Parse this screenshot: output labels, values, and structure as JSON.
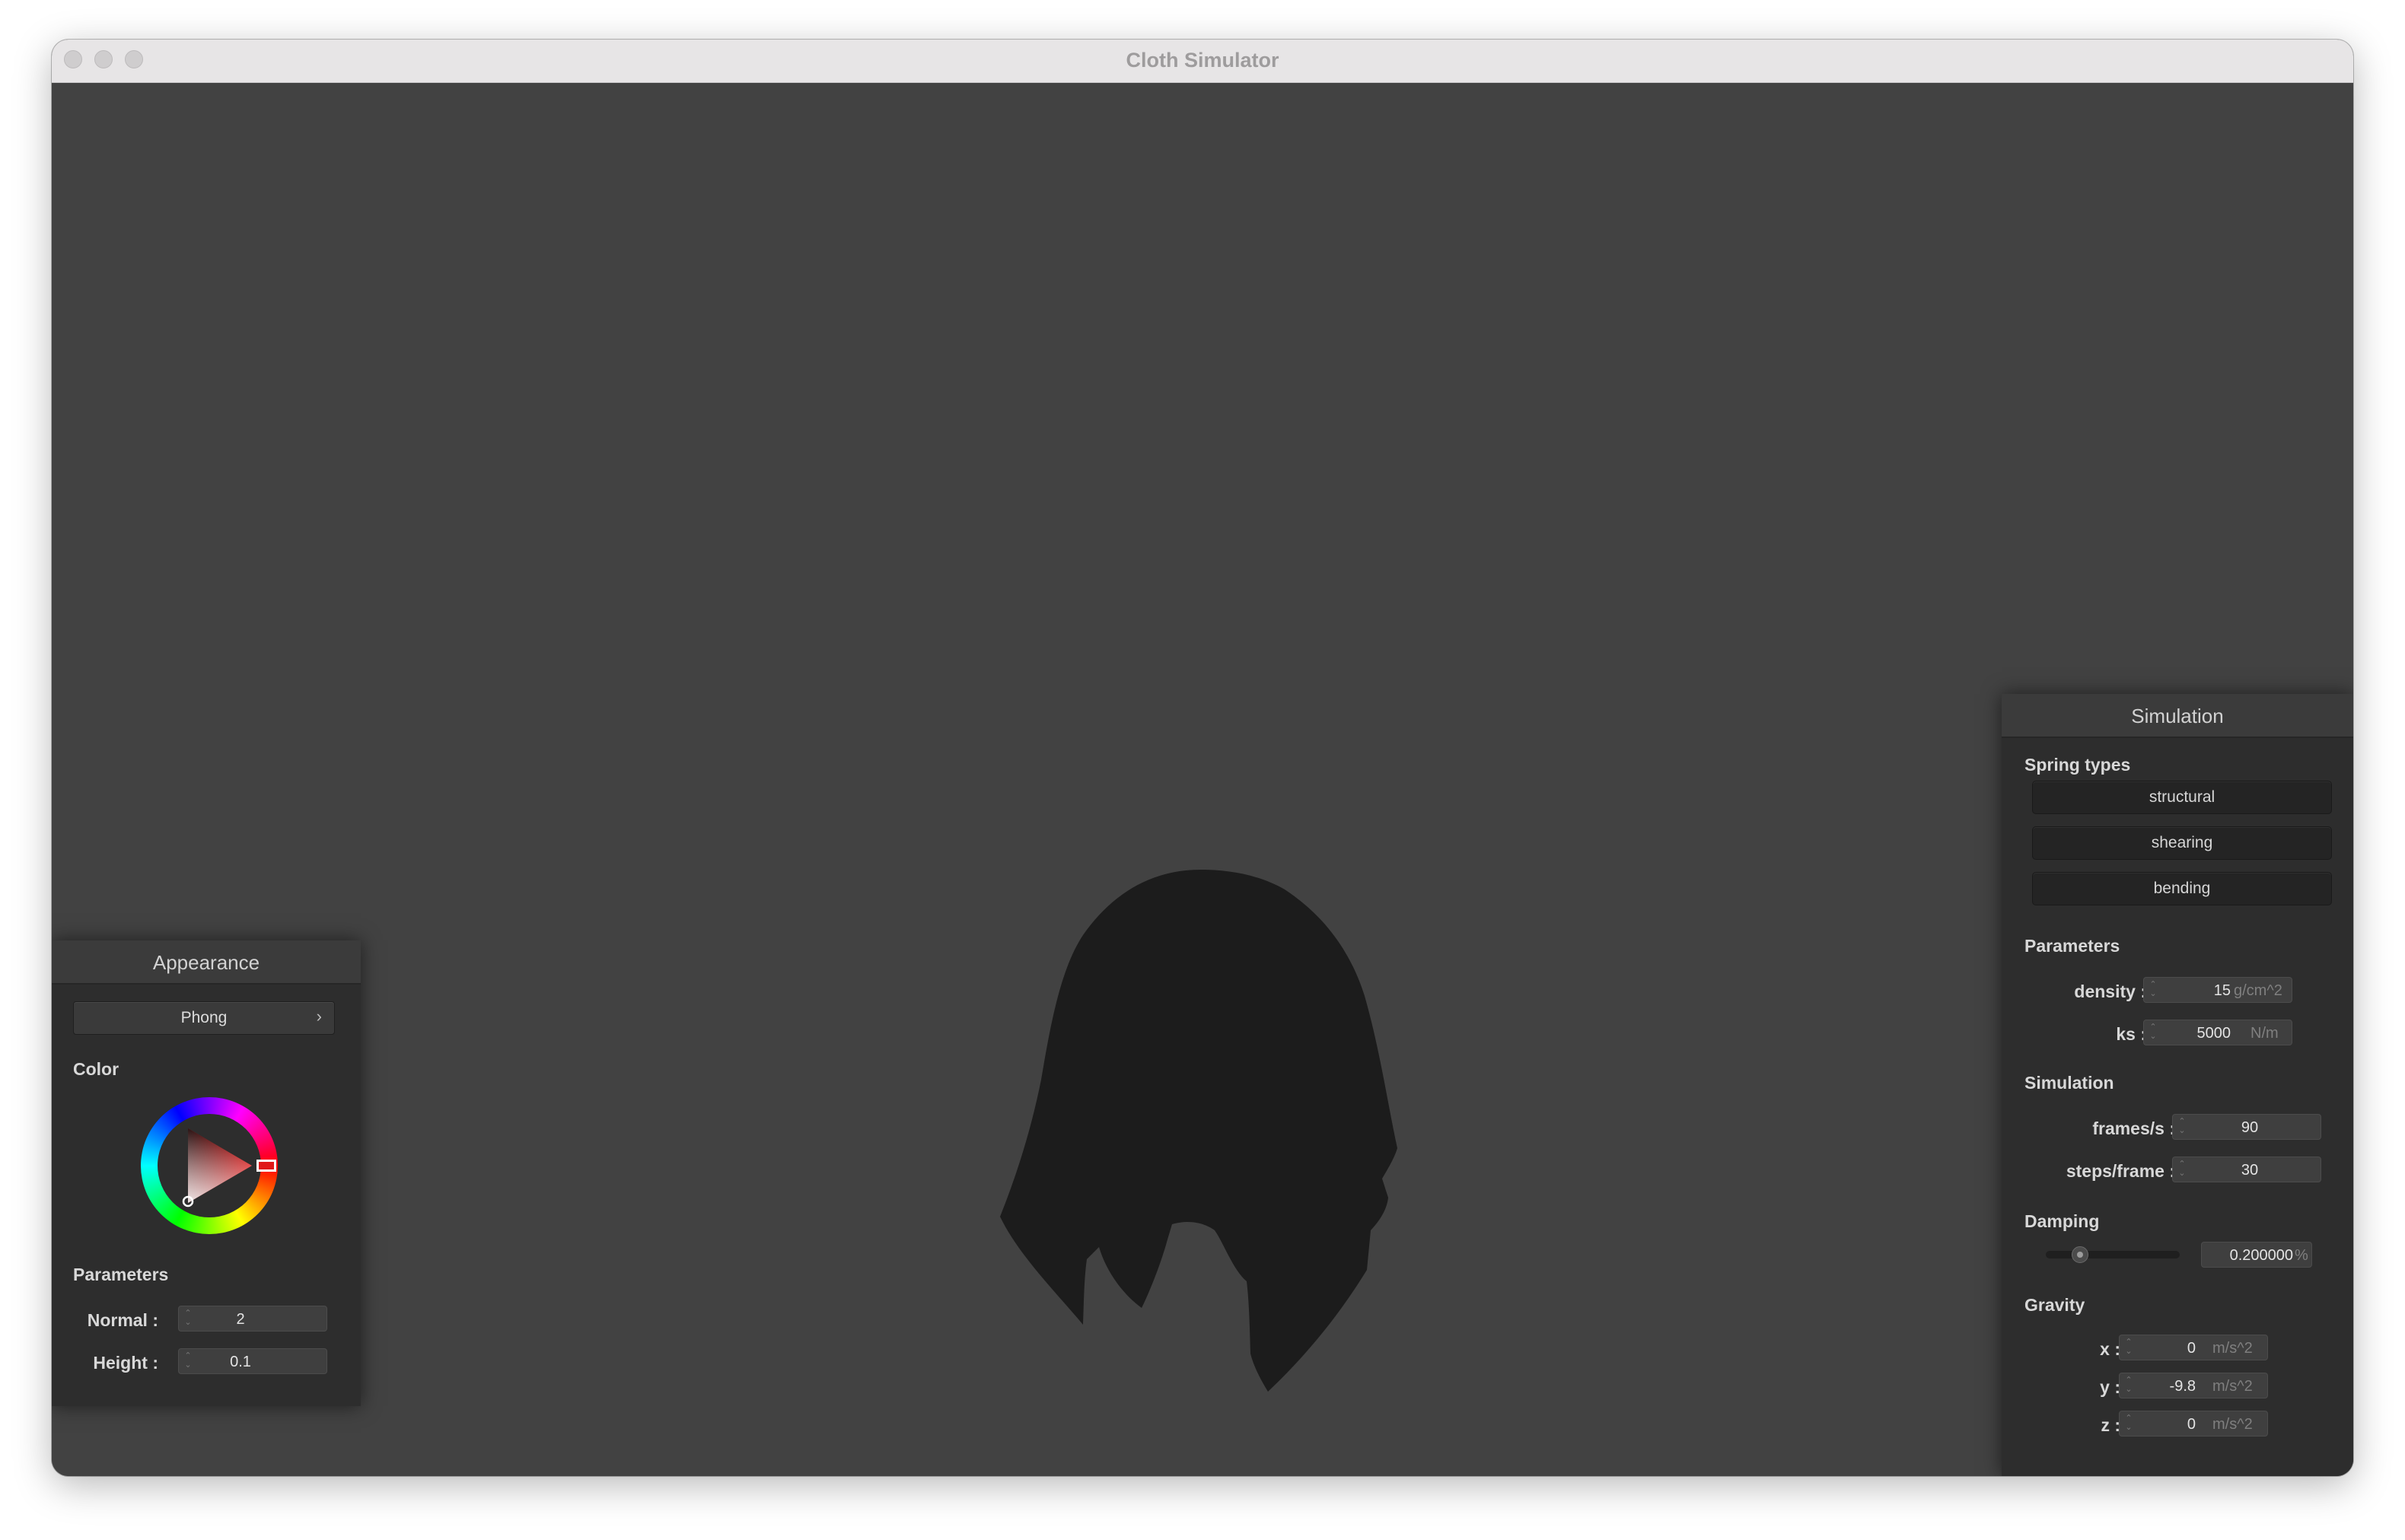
{
  "window": {
    "title": "Cloth Simulator"
  },
  "appearance": {
    "title": "Appearance",
    "shader": {
      "selected": "Phong",
      "arrow": "›"
    },
    "color_label": "Color",
    "color_hex": "#e01818",
    "parameters_label": "Parameters",
    "normal": {
      "label": "Normal :",
      "value": "2"
    },
    "height": {
      "label": "Height :",
      "value": "0.1"
    }
  },
  "simulation": {
    "title": "Simulation",
    "spring_types_label": "Spring types",
    "spring_buttons": [
      "structural",
      "shearing",
      "bending"
    ],
    "parameters_label": "Parameters",
    "density": {
      "label": "density :",
      "value": "15",
      "unit": "g/cm^2"
    },
    "ks": {
      "label": "ks :",
      "value": "5000",
      "unit": "N/m"
    },
    "simulation_label": "Simulation",
    "fps": {
      "label": "frames/s :",
      "value": "90"
    },
    "steps": {
      "label": "steps/frame :",
      "value": "30"
    },
    "damping_label": "Damping",
    "damping": {
      "value": "0.200000",
      "unit": "%",
      "slider_fraction": 0.2
    },
    "gravity_label": "Gravity",
    "gravity": {
      "x": {
        "label": "x :",
        "value": "0",
        "unit": "m/s^2"
      },
      "y": {
        "label": "y :",
        "value": "-9.8",
        "unit": "m/s^2"
      },
      "z": {
        "label": "z :",
        "value": "0",
        "unit": "m/s^2"
      }
    }
  },
  "colors": {
    "viewport_bg": "#424242",
    "cloth": "#1c1c1c",
    "panel_bg": "#2d2d2d"
  },
  "icons": [
    "close-icon",
    "minimize-icon",
    "zoom-icon",
    "spin-arrows-icon",
    "chevron-right-icon"
  ]
}
